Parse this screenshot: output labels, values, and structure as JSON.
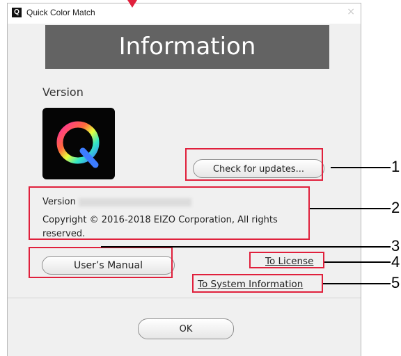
{
  "window": {
    "title": "Quick Color Match",
    "app_icon_letter": "Q",
    "close_glyph": "×"
  },
  "banner": {
    "title": "Information"
  },
  "version_heading": "Version",
  "check_updates_label": "Check for updates...",
  "info": {
    "version_label": "Version",
    "copyright": "Copyright © 2016-2018 EIZO Corporation, All rights reserved."
  },
  "manual_label": "User’s Manual",
  "license_link": "To License",
  "sysinfo_link": "To System Information",
  "ok_label": "OK",
  "callouts": [
    "1",
    "2",
    "3",
    "4",
    "5"
  ],
  "colors": {
    "highlight": "#e0203c",
    "banner_bg": "#636363",
    "window_bg": "#f0f0f0"
  }
}
